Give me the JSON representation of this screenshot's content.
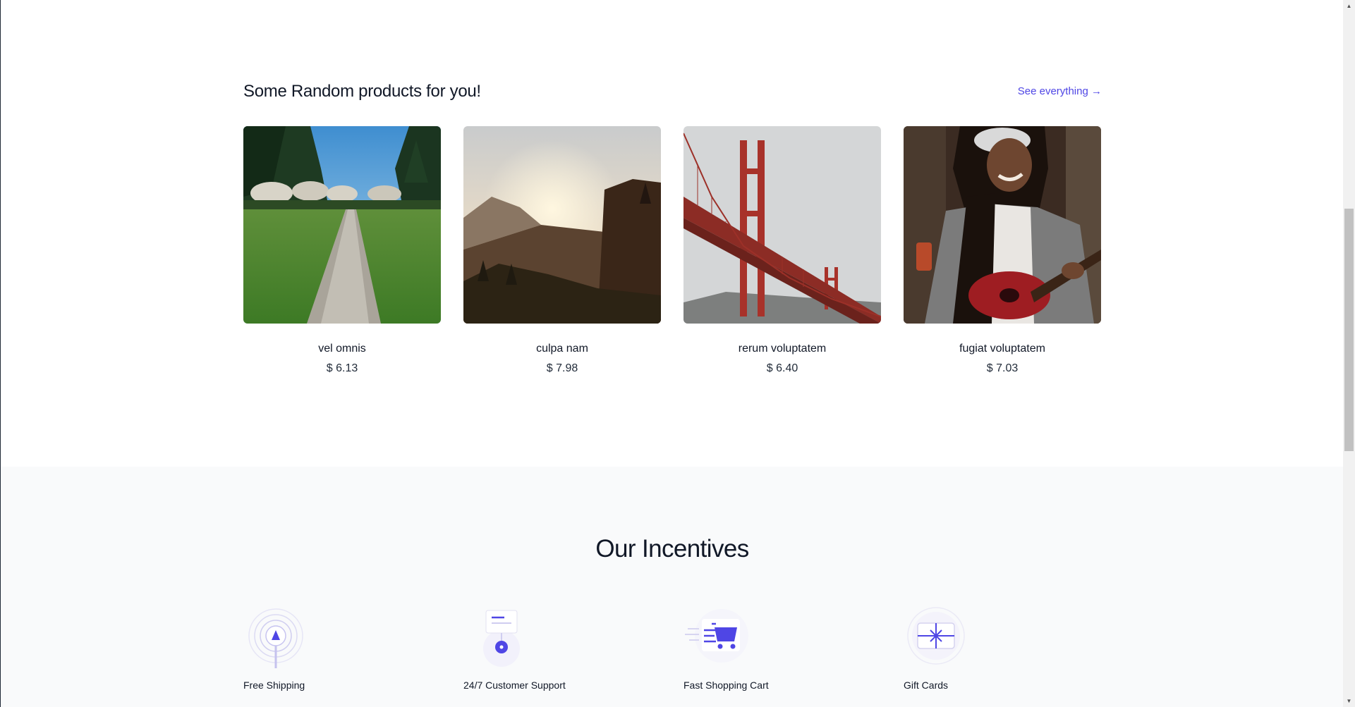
{
  "products_section": {
    "title": "Some Random products for you!",
    "see_all_label": "See everything →",
    "items": [
      {
        "name": "vel omnis",
        "price": "$ 6.13",
        "image": "forest-path-photo"
      },
      {
        "name": "culpa nam",
        "price": "$ 7.98",
        "image": "mountain-sunset-photo"
      },
      {
        "name": "rerum voluptatem",
        "price": "$ 6.40",
        "image": "golden-gate-bridge-photo"
      },
      {
        "name": "fugiat voluptatem",
        "price": "$ 7.03",
        "image": "woman-guitar-photo"
      }
    ]
  },
  "incentives_section": {
    "title": "Our Incentives",
    "items": [
      {
        "name": "Free Shipping",
        "icon": "shipping-arrow-icon"
      },
      {
        "name": "24/7 Customer Support",
        "icon": "support-chat-icon"
      },
      {
        "name": "Fast Shopping Cart",
        "icon": "shopping-cart-icon"
      },
      {
        "name": "Gift Cards",
        "icon": "gift-card-icon"
      }
    ]
  },
  "colors": {
    "accent": "#4f46e5",
    "incentives_bg": "#f9fafb",
    "text": "#111827"
  }
}
